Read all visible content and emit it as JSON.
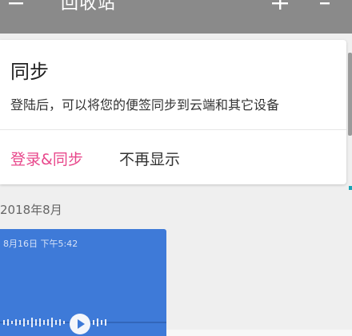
{
  "app_bar": {
    "title": "回收站",
    "menu_icon": "menu-icon",
    "add_icon": "add-icon",
    "sort_icon": "sort-icon",
    "background": "#8a8a8a"
  },
  "sync_card": {
    "heading": "同步",
    "description": "登陆后，可以将您的便签同步到云端和其它设备",
    "login_label": "登录&同步",
    "dismiss_label": "不再显示",
    "accent_color": "#e8478b"
  },
  "section": {
    "label": "2018年8月"
  },
  "notes": [
    {
      "date": "8月16日 下午5:42",
      "type": "voice",
      "play_icon": "play-icon",
      "color": "#3e7ad8"
    }
  ]
}
